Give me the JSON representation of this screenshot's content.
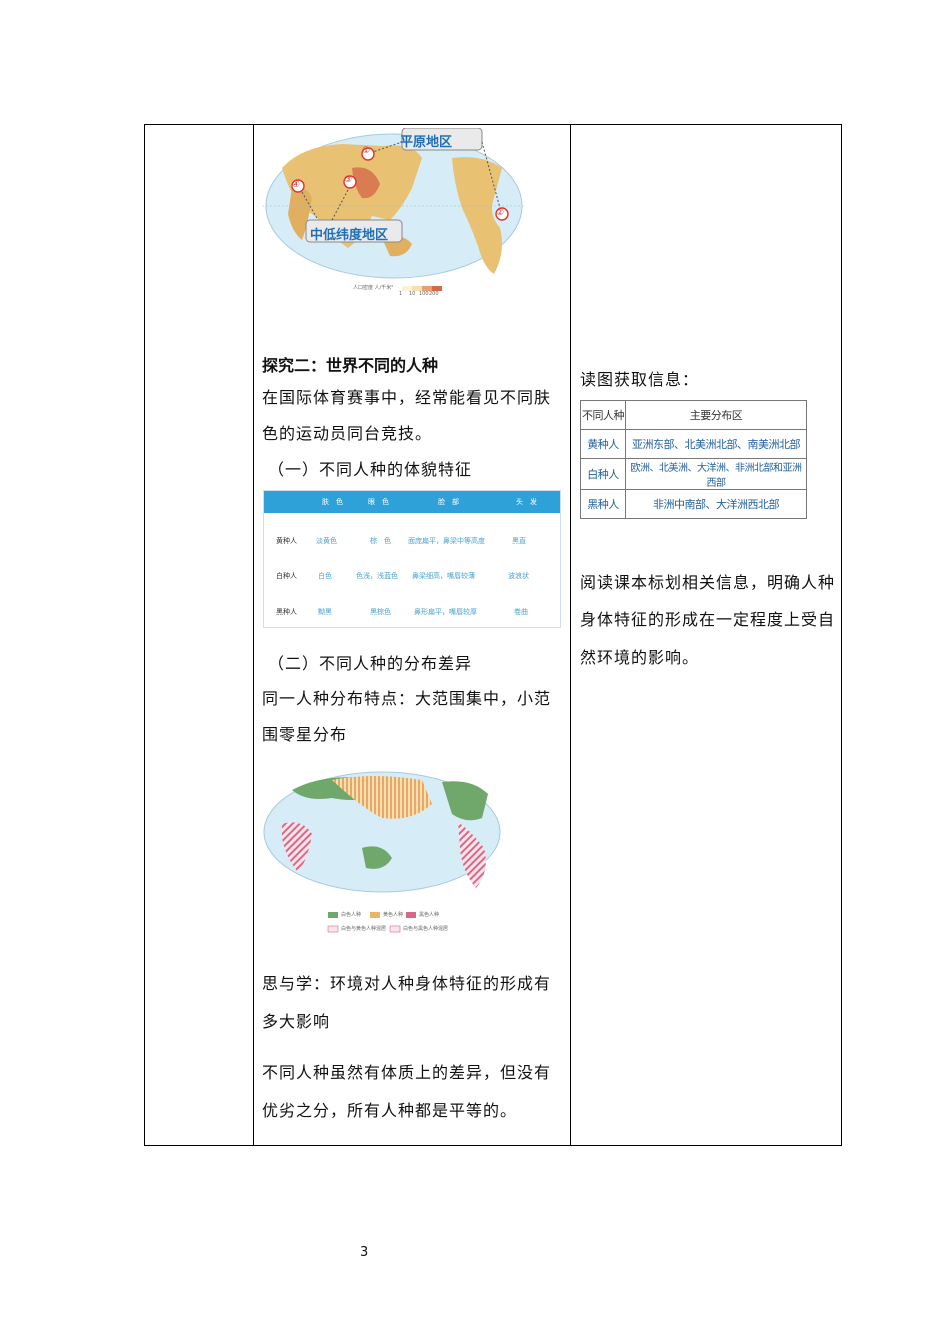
{
  "map1": {
    "callout_plains": "平原地区",
    "callout_lowmid": "中低纬度地区",
    "markers": [
      "①",
      "②",
      "③",
      "④"
    ],
    "legend_label": "人口密度 人/千米²",
    "legend_values": [
      "1",
      "10",
      "100",
      "200"
    ],
    "colors": {
      "land": "#e8c173",
      "dense": "#d46a4a",
      "ocean": "#d6ecf6",
      "callout": "#1f6fb8"
    }
  },
  "section2": {
    "heading": "探究二：世界不同的人种",
    "intro": [
      "在国际体育赛事中，经常能看见不同肤",
      "色的运动员同台竞技。"
    ],
    "sub1": "（一）不同人种的体貌特征",
    "sub2": "（二）不同人种的分布差异",
    "dist_text": [
      "同一人种分布特点：大范围集中，小范",
      "围零星分布"
    ],
    "think": [
      "思与学：环境对人种身体特征的形成有",
      "多大影响"
    ],
    "conclusion": [
      "不同人种虽然有体质上的差异，但没有",
      "优劣之分，所有人种都是平等的。"
    ]
  },
  "features_table": {
    "headers": [
      "肤　色",
      "眼　色",
      "脸　部",
      "头　发"
    ],
    "rows": [
      [
        "黄种人",
        "淡黄色",
        "棕　色",
        "面庞扁平，鼻梁中等高度",
        "黑直"
      ],
      [
        "白种人",
        "白色",
        "色浅，浅蓝色",
        "鼻梁细高，嘴唇较薄",
        "波浪状"
      ],
      [
        "黑种人",
        "黝黑",
        "黑棕色",
        "鼻形扁平，嘴唇较厚",
        "卷曲"
      ]
    ],
    "header_color": "#2ea2d8"
  },
  "map2": {
    "legend": [
      "白色人种",
      "黄色人种",
      "黑色人种",
      "白色与黄色人种混居",
      "白色与黑色人种混居"
    ],
    "colors": {
      "white_race": "#6fa86a",
      "yellow_race": "#e8b56a",
      "black_race": "#d46a8a"
    }
  },
  "right": {
    "read_info": "读图获取信息：",
    "table": {
      "headers": [
        "不同人种",
        "主要分布区"
      ],
      "rows": [
        [
          "黄种人",
          "亚洲东部、北美洲北部、南美洲北部"
        ],
        [
          "白种人",
          "欧洲、北美洲、大洋洲、非洲北部和亚洲西部"
        ],
        [
          "黑种人",
          "非洲中南部、大洋洲西北部"
        ]
      ]
    },
    "note": [
      "阅读课本标划相关信息，明确人种",
      "身体特征的形成在一定程度上受自",
      "然环境的影响。"
    ]
  },
  "page_number": "3"
}
